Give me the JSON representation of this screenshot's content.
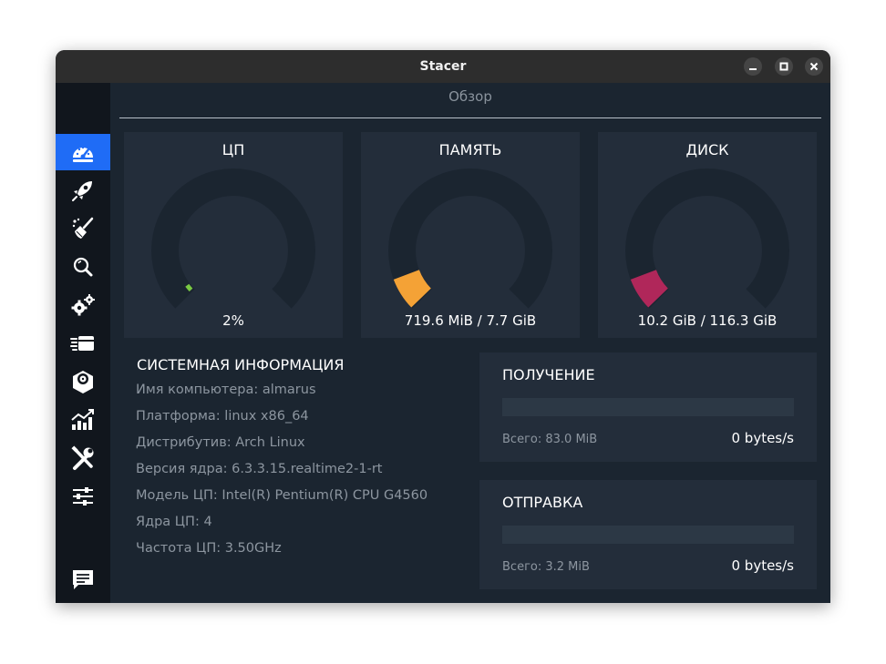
{
  "window": {
    "title": "Stacer"
  },
  "titlebar": {
    "buttons": [
      "minimize-icon",
      "maximize-icon",
      "close-icon"
    ]
  },
  "sidebar": {
    "items": [
      {
        "icon": "dashboard-speedometer-icon",
        "active": true
      },
      {
        "icon": "rocket-startup-apps-icon",
        "active": false
      },
      {
        "icon": "broom-cleaner-icon",
        "active": false
      },
      {
        "icon": "magnifier-search-icon",
        "active": false
      },
      {
        "icon": "gears-services-icon",
        "active": false
      },
      {
        "icon": "processes-icon",
        "active": false
      },
      {
        "icon": "package-uninstaller-icon",
        "active": false
      },
      {
        "icon": "bar-chart-resources-icon",
        "active": false
      },
      {
        "icon": "tools-helpers-icon",
        "active": false
      },
      {
        "icon": "sliders-settings-icon",
        "active": false
      }
    ],
    "footer_icon": "feedback-message-icon"
  },
  "page": {
    "title": "Обзор"
  },
  "gauges": [
    {
      "label": "ЦП",
      "value": "2%",
      "fraction": 0.02,
      "color": "#7ac943"
    },
    {
      "label": "ПАМЯТЬ",
      "value": "719.6 MiB / 7.7 GiB",
      "fraction": 0.09,
      "color": "#f4a236"
    },
    {
      "label": "ДИСК",
      "value": "10.2 GiB / 116.3 GiB",
      "fraction": 0.09,
      "color": "#b0275a"
    }
  ],
  "sysinfo": {
    "heading": "СИСТЕМНАЯ ИНФОРМАЦИЯ",
    "rows": [
      "Имя компьютера: almarus",
      "Платформа: linux x86_64",
      "Дистрибутив: Arch Linux",
      "Версия ядра: 6.3.3.15.realtime2-1-rt",
      "Модель ЦП: Intel(R) Pentium(R) CPU G4560",
      "Ядра ЦП: 4",
      "Частота ЦП: 3.50GHz"
    ]
  },
  "network": {
    "download": {
      "label": "ПОЛУЧЕНИЕ",
      "total": "Всего: 83.0 MiB",
      "rate": "0 bytes/s"
    },
    "upload": {
      "label": "ОТПРАВКА",
      "total": "Всего: 3.2 MiB",
      "rate": "0 bytes/s"
    }
  },
  "colors": {
    "accent": "#1f6cf6",
    "gauge_track": "#1b2530"
  }
}
